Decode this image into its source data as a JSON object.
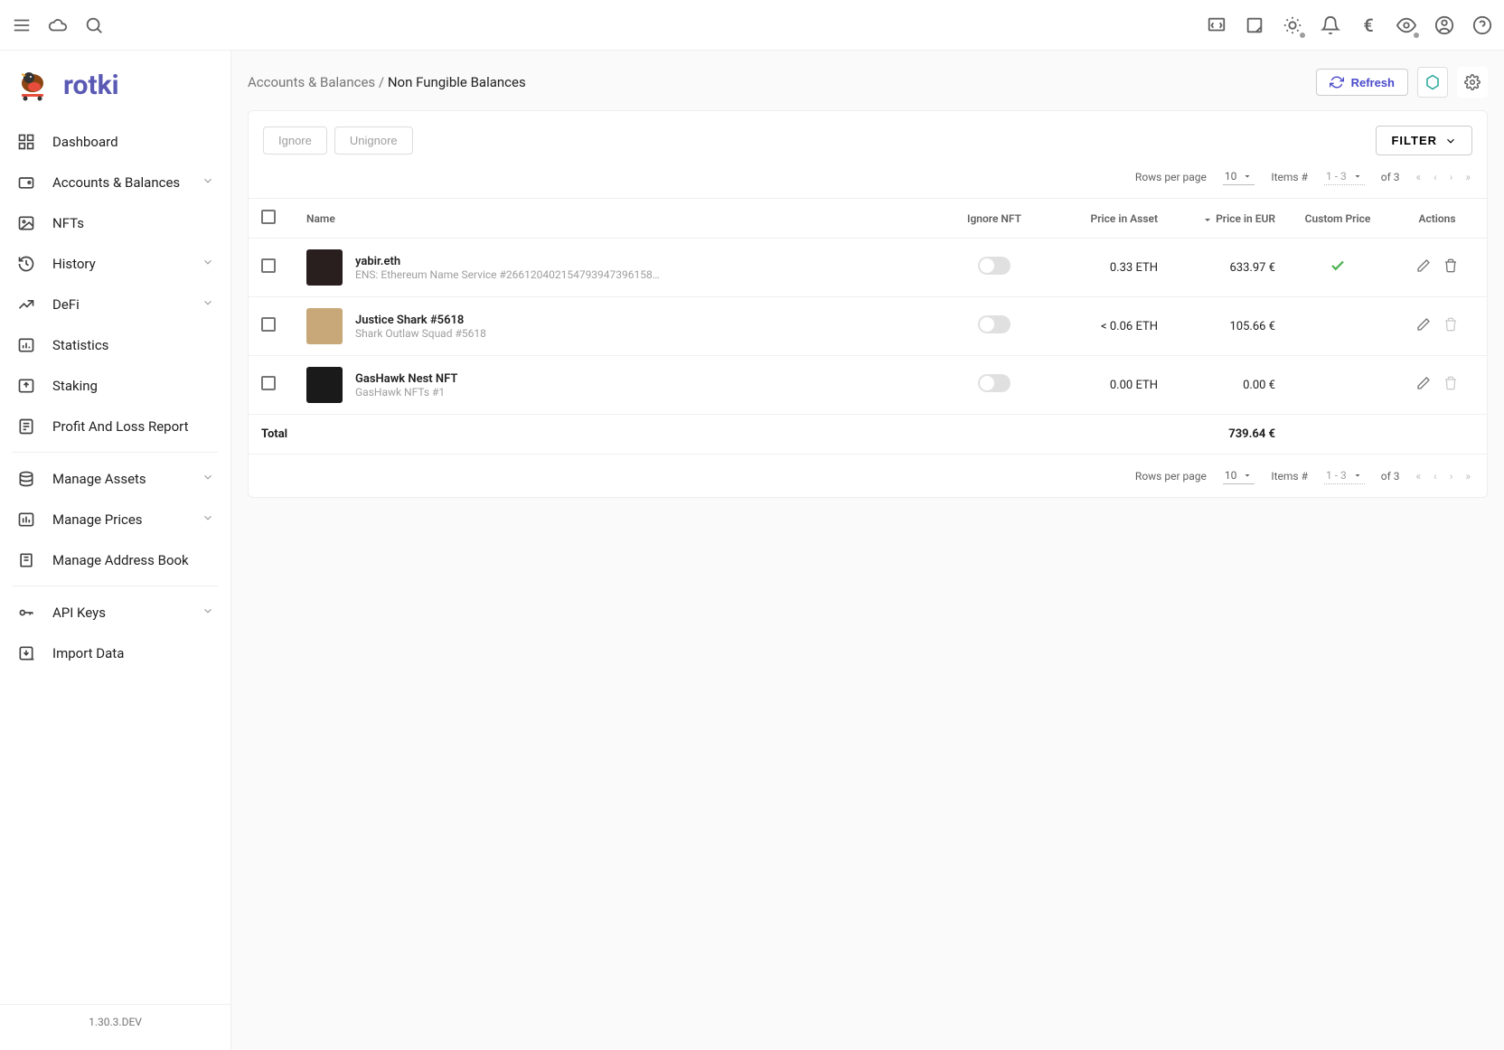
{
  "app": {
    "name": "rotki",
    "version": "1.30.3.DEV"
  },
  "sidebar": {
    "items": [
      {
        "label": "Dashboard"
      },
      {
        "label": "Accounts & Balances",
        "expandable": true
      },
      {
        "label": "NFTs"
      },
      {
        "label": "History",
        "expandable": true
      },
      {
        "label": "DeFi",
        "expandable": true
      },
      {
        "label": "Statistics"
      },
      {
        "label": "Staking"
      },
      {
        "label": "Profit And Loss Report"
      }
    ],
    "items2": [
      {
        "label": "Manage Assets",
        "expandable": true
      },
      {
        "label": "Manage Prices",
        "expandable": true
      },
      {
        "label": "Manage Address Book"
      }
    ],
    "items3": [
      {
        "label": "API Keys",
        "expandable": true
      },
      {
        "label": "Import Data"
      }
    ]
  },
  "breadcrumb": {
    "parent": "Accounts & Balances",
    "sep": " / ",
    "current": "Non Fungible Balances"
  },
  "header": {
    "refresh": "Refresh"
  },
  "controls": {
    "ignore": "Ignore",
    "unignore": "Unignore",
    "filter": "FILTER"
  },
  "table": {
    "columns": {
      "name": "Name",
      "ignore": "Ignore NFT",
      "price_asset": "Price in Asset",
      "price_eur": "Price in EUR",
      "custom_price": "Custom Price",
      "actions": "Actions"
    },
    "rows": [
      {
        "name": "yabir.eth",
        "sub": "ENS: Ethereum Name Service #2661204021547939473961581...",
        "price_asset": "0.33 ETH",
        "price_eur": "633.97 €",
        "custom_price": true,
        "delete": true,
        "img_color": "#2a1f1f"
      },
      {
        "name": "Justice Shark #5618",
        "sub": "Shark Outlaw Squad #5618",
        "price_asset": "< 0.06 ETH",
        "price_eur": "105.66 €",
        "custom_price": false,
        "delete": false,
        "img_color": "#c8a878"
      },
      {
        "name": "GasHawk Nest NFT",
        "sub": "GasHawk NFTs #1",
        "price_asset": "0.00 ETH",
        "price_eur": "0.00 €",
        "custom_price": false,
        "delete": false,
        "img_color": "#1a1a1a"
      }
    ],
    "total_label": "Total",
    "total_eur": "739.64 €"
  },
  "pager": {
    "rows_label": "Rows per page",
    "rows_value": "10",
    "items_label": "Items #",
    "range": "1 - 3",
    "of_label": "of 3"
  }
}
